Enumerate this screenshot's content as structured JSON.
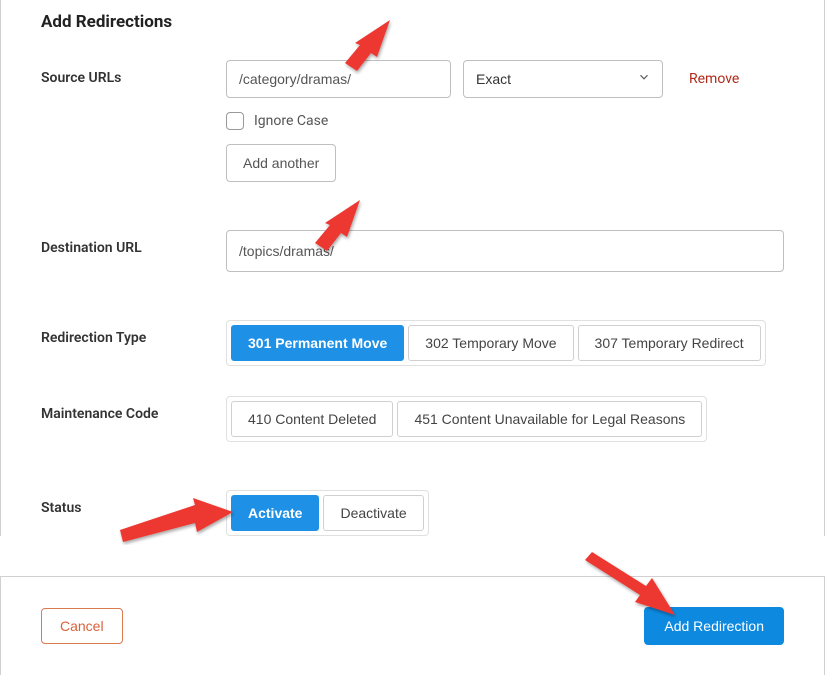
{
  "heading": "Add Redirections",
  "labels": {
    "source": "Source URLs",
    "destination": "Destination URL",
    "redirection_type": "Redirection Type",
    "maintenance_code": "Maintenance Code",
    "status": "Status"
  },
  "source": {
    "value": "/category/dramas/",
    "match_type": "Exact",
    "remove": "Remove",
    "ignore_case": "Ignore Case",
    "add_another": "Add another"
  },
  "destination": {
    "value": "/topics/dramas/"
  },
  "redirection_types": {
    "opt_301": "301 Permanent Move",
    "opt_302": "302 Temporary Move",
    "opt_307": "307 Temporary Redirect"
  },
  "maintenance_codes": {
    "opt_410": "410 Content Deleted",
    "opt_451": "451 Content Unavailable for Legal Reasons"
  },
  "status": {
    "activate": "Activate",
    "deactivate": "Deactivate"
  },
  "footer": {
    "cancel": "Cancel",
    "submit": "Add Redirection"
  },
  "colors": {
    "primary": "#0d8ae0",
    "accent_red": "#b02a1a",
    "cancel_border": "#d97a4f",
    "arrow": "#ed3833"
  }
}
